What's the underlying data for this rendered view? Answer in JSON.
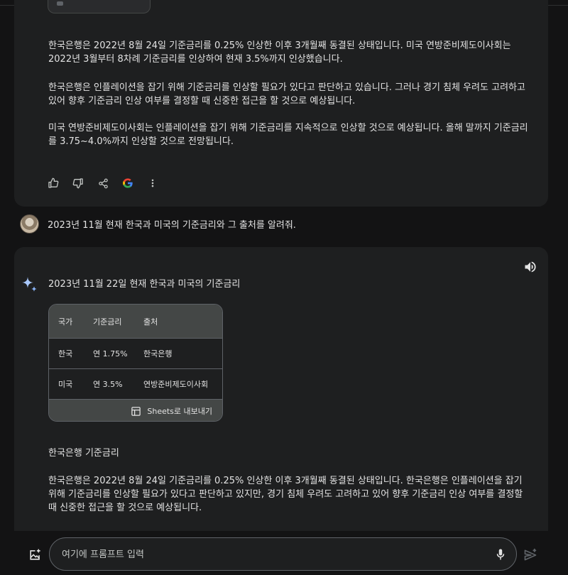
{
  "response1": {
    "paragraphs": [
      "한국은행은 2022년 8월 24일 기준금리를 0.25% 인상한 이후 3개월째 동결된 상태입니다. 미국 연방준비제도이사회는 2022년 3월부터 8차례 기준금리를 인상하여 현재 3.5%까지 인상했습니다.",
      "한국은행은 인플레이션을 잡기 위해 기준금리를 인상할 필요가 있다고 판단하고 있습니다. 그러나 경기 침체 우려도 고려하고 있어 향후 기준금리 인상 여부를 결정할 때 신중한 접근을 할 것으로 예상됩니다.",
      "미국 연방준비제도이사회는 인플레이션을 잡기 위해 기준금리를 지속적으로 인상할 것으로 예상됩니다. 올해 말까지 기준금리를 3.75~4.0%까지 인상할 것으로 전망됩니다."
    ],
    "actions": [
      "thumb-up",
      "thumb-down",
      "share",
      "google",
      "more"
    ]
  },
  "user_message": "2023년 11월 현재 한국과 미국의 기준금리와 그 출처를 알려줘.",
  "response2": {
    "heading": "2023년 11월 22일 현재 한국과 미국의 기준금리",
    "table": {
      "headers": [
        "국가",
        "기준금리",
        "출처"
      ],
      "rows": [
        [
          "한국",
          "연 1.75%",
          "한국은행"
        ],
        [
          "미국",
          "연 3.5%",
          "연방준비제도이사회"
        ]
      ],
      "export_label": "Sheets로 내보내기"
    },
    "subheading": "한국은행 기준금리",
    "paragraph": "한국은행은 2022년 8월 24일 기준금리를 0.25% 인상한 이후 3개월째 동결된 상태입니다. 한국은행은 인플레이션을 잡기 위해 기준금리를 인상할 필요가 있다고 판단하고 있지만, 경기 침체 우려도 고려하고 있어 향후 기준금리 인상 여부를 결정할 때 신중한 접근을 할 것으로 예상됩니다."
  },
  "prompt": {
    "placeholder": "여기에 프롬프트 입력",
    "value": ""
  },
  "colors": {
    "background": "#131314",
    "card": "#1e1f20",
    "table_header": "#444746",
    "text": "#e3e3e3",
    "spark": "#a8c7fa"
  }
}
